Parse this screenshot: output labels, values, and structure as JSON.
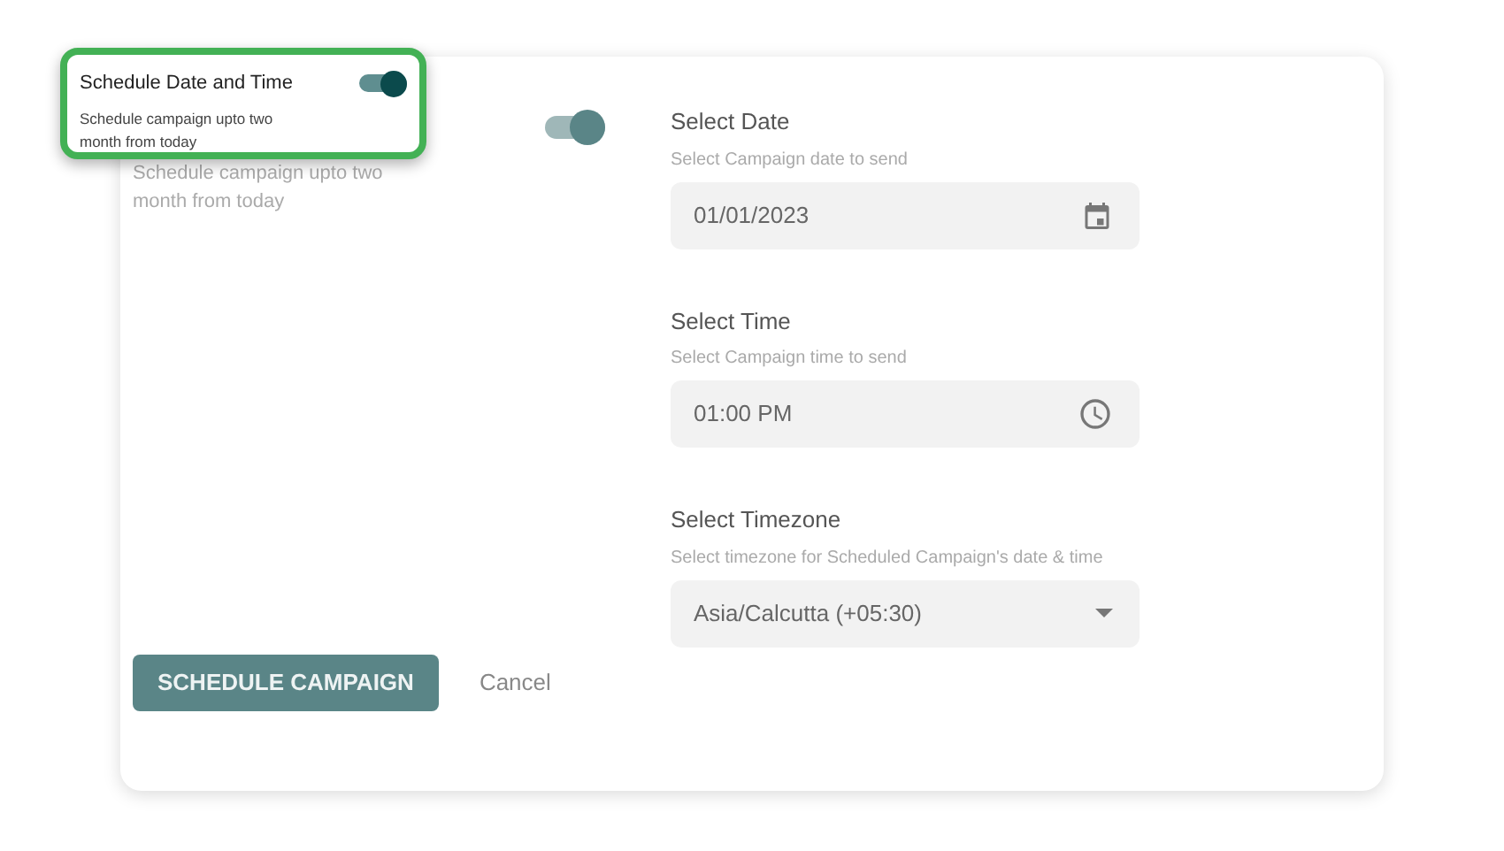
{
  "callout": {
    "title": "Schedule Date and Time",
    "description": "Schedule campaign upto two month from today",
    "on": true
  },
  "card": {
    "schedule_toggle": {
      "on": true
    },
    "description": "Schedule campaign upto two month from today",
    "fields": [
      {
        "kind": "date",
        "label": "Select Date",
        "hint": "Select Campaign date to send",
        "value": "01/01/2023"
      },
      {
        "kind": "time",
        "label": "Select Time",
        "hint": "Select Campaign time to send",
        "value": "01:00 PM"
      },
      {
        "kind": "select",
        "label": "Select Timezone",
        "hint": "Select timezone for Scheduled Campaign's date & time",
        "value": "Asia/Calcutta (+05:30)"
      }
    ],
    "submit_button": "SCHEDULE CAMPAIGN",
    "cancel_link": "Cancel"
  }
}
